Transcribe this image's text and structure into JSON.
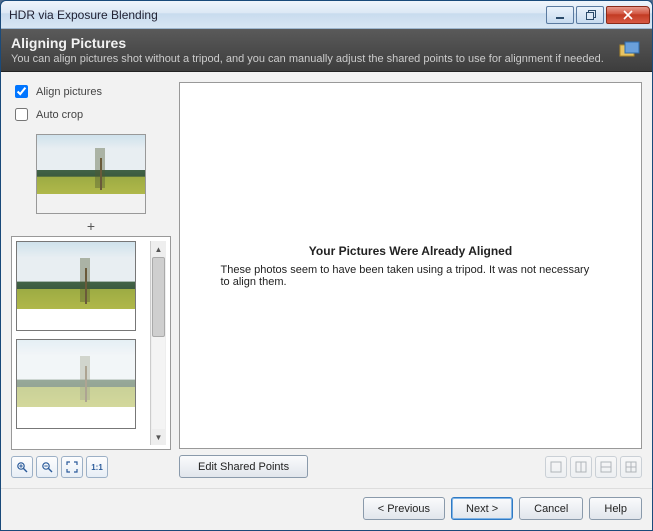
{
  "window": {
    "title": "HDR via Exposure Blending"
  },
  "header": {
    "title": "Aligning Pictures",
    "subtitle": "You can align pictures shot without a tripod, and you can manually adjust the shared points to use for alignment if needed."
  },
  "options": {
    "align_label": "Align pictures",
    "align_checked": true,
    "autocrop_label": "Auto crop",
    "autocrop_checked": false
  },
  "combine_symbol": "+",
  "message": {
    "title": "Your Pictures Were Already Aligned",
    "body": "These photos seem to have been taken using a tripod. It was not necessary to align them."
  },
  "buttons": {
    "edit_shared_points": "Edit Shared Points",
    "previous": "< Previous",
    "next": "Next >",
    "cancel": "Cancel",
    "help": "Help"
  },
  "zoom": {
    "ratio_label": "1:1"
  },
  "icons": {
    "minimize": "minimize-icon",
    "maximize": "maximize-icon",
    "close": "close-icon",
    "header": "layers-icon",
    "zoom_in": "zoom-in-icon",
    "zoom_out": "zoom-out-icon",
    "fit": "fit-screen-icon",
    "ratio": "ratio-1-1-icon",
    "layout1": "single-pane-icon",
    "layout2": "split-vertical-icon",
    "layout3": "split-horizontal-icon",
    "layout4": "grid-icon"
  }
}
